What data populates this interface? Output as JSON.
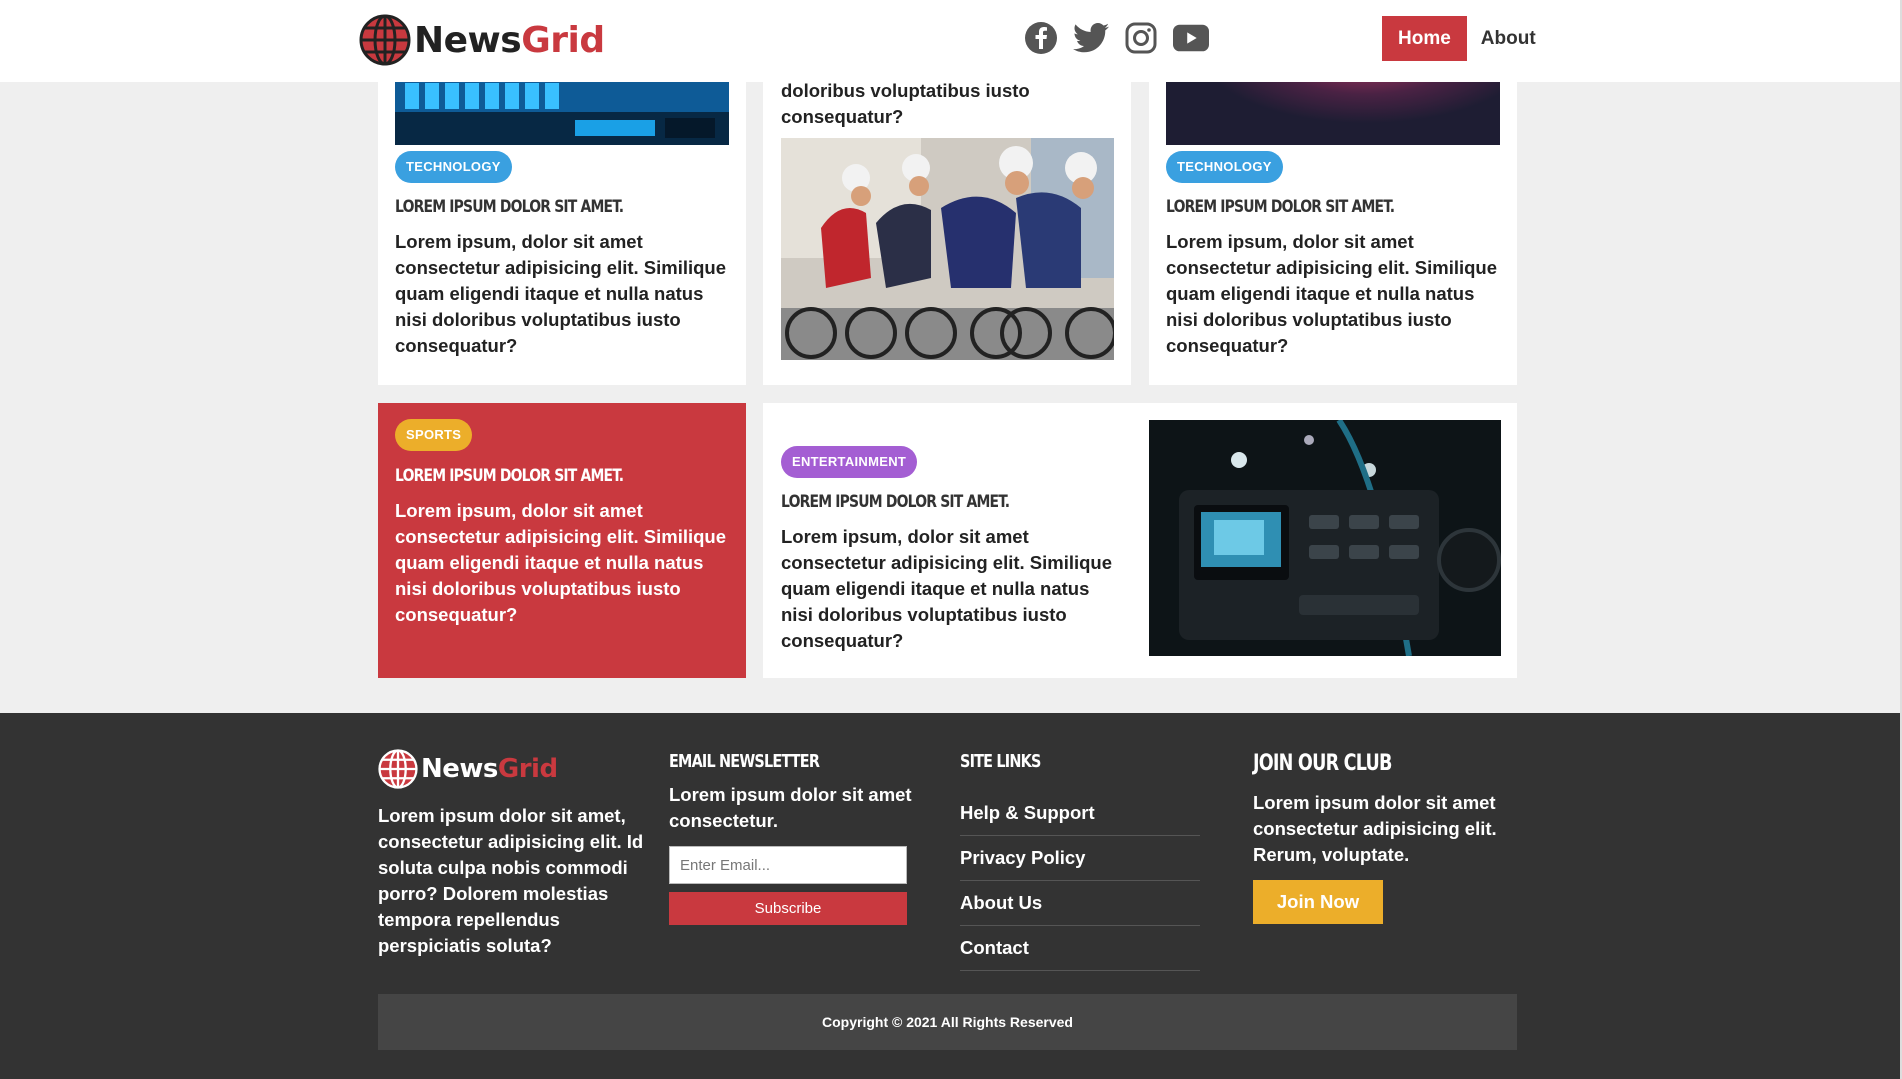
{
  "brand": {
    "name_main": "News",
    "name_accent": "Grid"
  },
  "header": {
    "social_icons": [
      "facebook-icon",
      "twitter-icon",
      "instagram-icon",
      "youtube-icon"
    ],
    "nav": {
      "home": "Home",
      "about": "About"
    }
  },
  "cards": [
    {
      "category": "TECHNOLOGY",
      "headline": "LOREM IPSUM DOLOR SIT AMET.",
      "body": "Lorem ipsum, dolor sit amet consectetur adipisicing elit. Similique quam eligendi itaque et nulla natus nisi doloribus voluptatibus iusto consequatur?"
    },
    {
      "body_partial": "doloribus voluptatibus iusto consequatur?"
    },
    {
      "category": "TECHNOLOGY",
      "headline": "LOREM IPSUM DOLOR SIT AMET.",
      "body": "Lorem ipsum, dolor sit amet consectetur adipisicing elit. Similique quam eligendi itaque et nulla natus nisi doloribus voluptatibus iusto consequatur?"
    },
    {
      "category": "SPORTS",
      "headline": "LOREM IPSUM DOLOR SIT AMET.",
      "body": "Lorem ipsum, dolor sit amet consectetur adipisicing elit. Similique quam eligendi itaque et nulla natus nisi doloribus voluptatibus iusto consequatur?"
    },
    {
      "category": "ENTERTAINMENT",
      "headline": "LOREM IPSUM DOLOR SIT AMET.",
      "body": "Lorem ipsum, dolor sit amet consectetur adipisicing elit. Similique quam eligendi itaque et nulla natus nisi doloribus voluptatibus iusto consequatur?"
    }
  ],
  "footer": {
    "about": "Lorem ipsum dolor sit amet, consectetur adipisicing elit. Id soluta culpa nobis commodi porro? Dolorem molestias tempora repellendus perspiciatis soluta?",
    "newsletter": {
      "heading": "EMAIL NEWSLETTER",
      "text": "Lorem ipsum dolor sit amet consectetur.",
      "email_placeholder": "Enter Email...",
      "button": "Subscribe"
    },
    "site_links": {
      "heading": "SITE LINKS",
      "items": [
        "Help & Support",
        "Privacy Policy",
        "About Us",
        "Contact"
      ]
    },
    "club": {
      "heading": "JOIN OUR CLUB",
      "text": "Lorem ipsum dolor sit amet consectetur adipisicing elit. Rerum, voluptate.",
      "button": "Join Now"
    },
    "copyright": "Copyright © 2021 All Rights Reserved"
  },
  "colors": {
    "brand_red": "#c9393f",
    "technology_badge": "#3aa0e0",
    "sports_badge": "#ecae2a",
    "entertainment_badge": "#a45ed3",
    "footer_bg": "#333333",
    "join_button": "#ecae2a"
  }
}
